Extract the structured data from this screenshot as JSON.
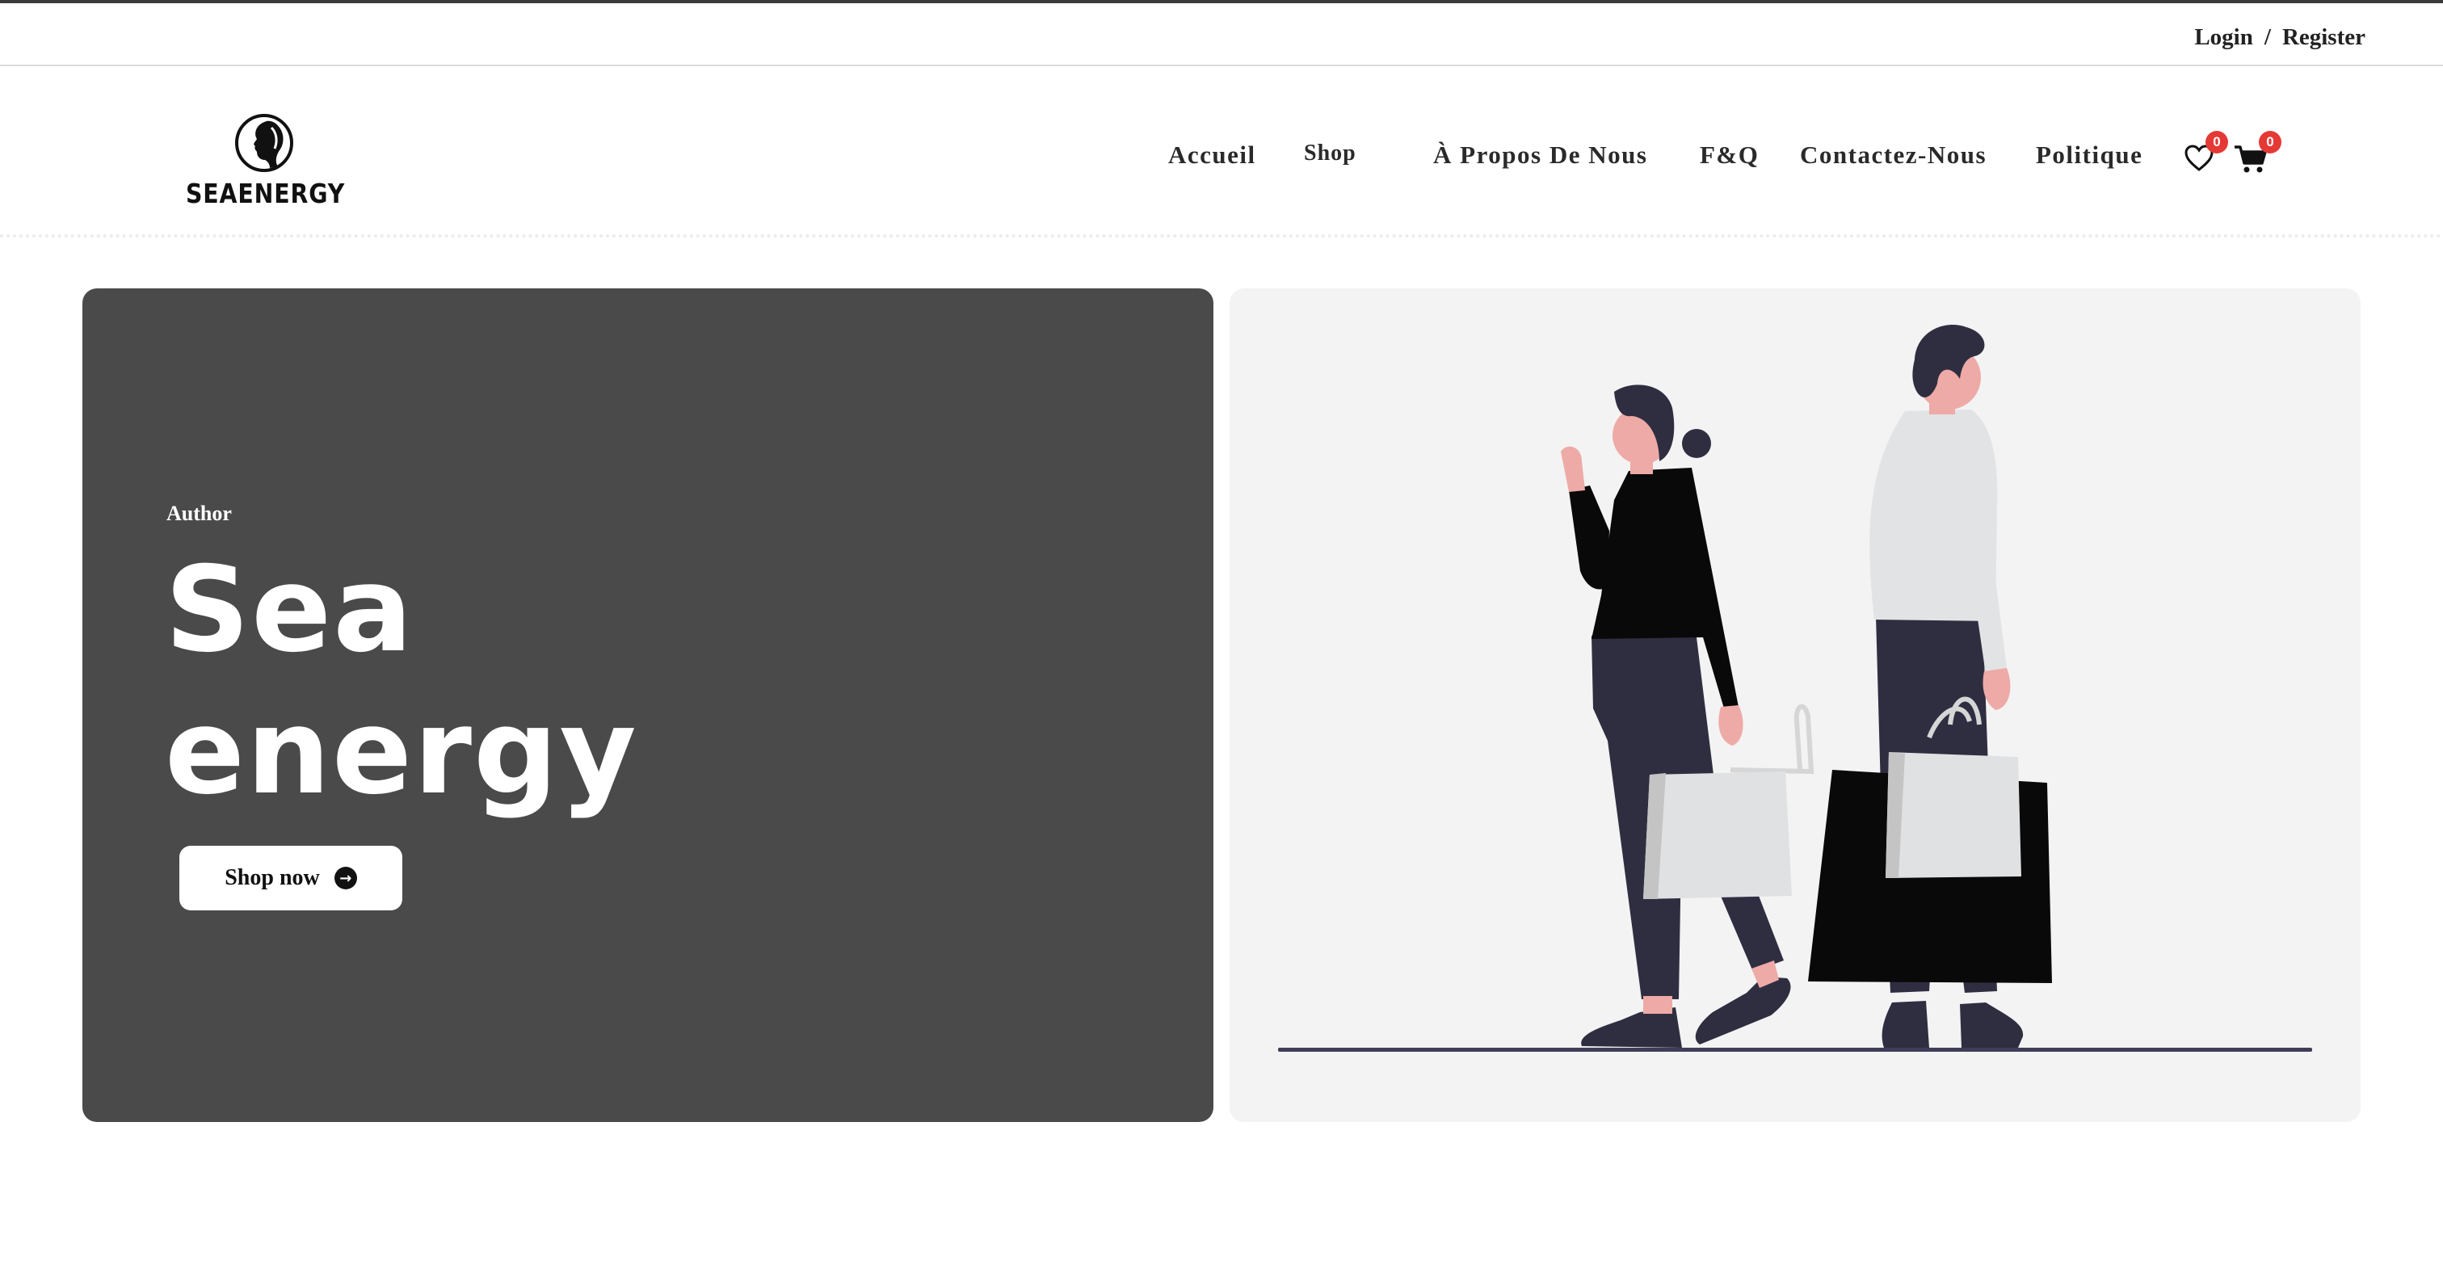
{
  "topbar": {
    "login": "Login",
    "separator": "/",
    "register": "Register"
  },
  "logo": {
    "text": "SEAENERGY"
  },
  "nav": {
    "items": [
      "Accueil",
      "Shop",
      "À Propos De Nous",
      "F&Q",
      "Contactez-Nous",
      "Politique"
    ],
    "wishlist": {
      "icon": "heart-icon",
      "count": "0"
    },
    "cart": {
      "icon": "cart-icon",
      "count": "0"
    }
  },
  "hero": {
    "eyebrow": "Author",
    "title": "Sea\nenergy",
    "button": {
      "label": "Shop now",
      "icon": "arrow-right-circle-icon"
    },
    "illustration": "two shoppers with shopping bags"
  },
  "colors": {
    "hero_left_bg": "#4a4a4a",
    "hero_right_bg": "#f3f3f3",
    "badge": "#e53935",
    "figure_dark": "#2f2e41",
    "skin": "#eeaaa6"
  }
}
